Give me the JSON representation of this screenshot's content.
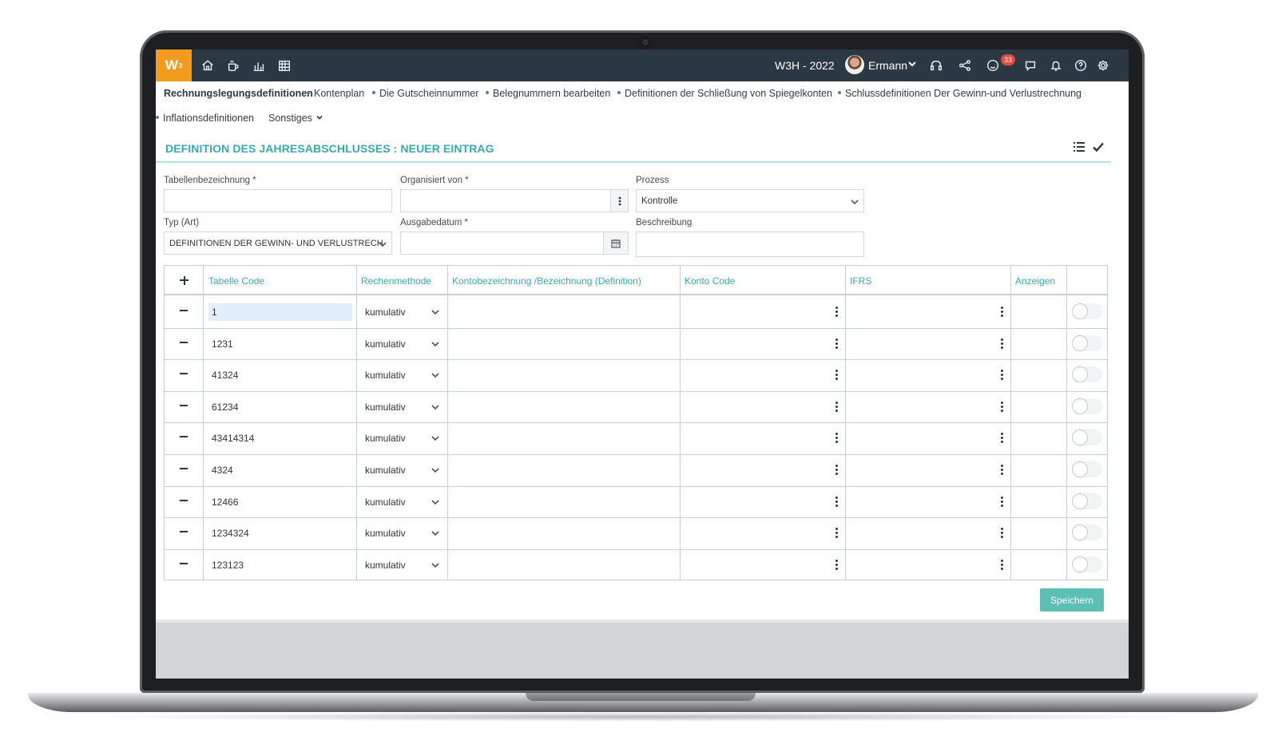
{
  "app": {
    "logo_text": "W",
    "logo_sup": "3",
    "company": "W3H - 2022",
    "user": "Ermann",
    "notification_count": "33",
    "colors": {
      "topbar": "#2c3843",
      "logo": "#f29b1f",
      "accent": "#3aa8b0",
      "save": "#5cbfb4",
      "badge": "#e34b3f"
    },
    "nav_icons": [
      "home-icon",
      "coffee-icon",
      "bar-chart-icon",
      "calendar-grid-icon"
    ],
    "right_icons": [
      "headset-icon",
      "share-icon",
      "smiley-icon",
      "chat-icon",
      "bell-icon",
      "help-icon",
      "gear-icon"
    ]
  },
  "menu": {
    "items": [
      "Rechnungslegungsdefinitionen",
      "Kontenplan",
      "Die Gutscheinnummer",
      "Belegnummern bearbeiten",
      "Definitionen der Schließung von Spiegelkonten",
      "Schlussdefinitionen Der Gewinn-und Verlustrechnung",
      "Inflationsdefinitionen"
    ],
    "more": "Sonstiges"
  },
  "page": {
    "title": "DEFINITION DES JAHRESABSCHLUSSES : NEUER EINTRAG"
  },
  "form": {
    "table_name_label": "Tabellenbezeichnung *",
    "table_name_value": "",
    "organized_by_label": "Organisiert von *",
    "organized_by_value": "",
    "process_label": "Prozess",
    "process_value": "Kontrolle",
    "type_label": "Typ (Art)",
    "type_value": "DEFINITIONEN DER GEWINN- UND VERLUSTRECH",
    "issue_date_label": "Ausgabedatum *",
    "issue_date_value": "",
    "description_label": "Beschreibung",
    "description_value": ""
  },
  "table": {
    "columns": [
      "Tabelle Code",
      "Rechenmethode",
      "Kontobezeichnung /Bezeichnung (Definition)",
      "Konto Code",
      "IFRS",
      "Anzeigen"
    ],
    "rows": [
      {
        "code": "1",
        "method": "kumulativ"
      },
      {
        "code": "1231",
        "method": "kumulativ"
      },
      {
        "code": "41324",
        "method": "kumulativ"
      },
      {
        "code": "61234",
        "method": "kumulativ"
      },
      {
        "code": "43414314",
        "method": "kumulativ"
      },
      {
        "code": "4324",
        "method": "kumulativ"
      },
      {
        "code": "12466",
        "method": "kumulativ"
      },
      {
        "code": "1234324",
        "method": "kumulativ"
      },
      {
        "code": "123123",
        "method": "kumulativ"
      }
    ]
  },
  "actions": {
    "save": "Speichern"
  }
}
